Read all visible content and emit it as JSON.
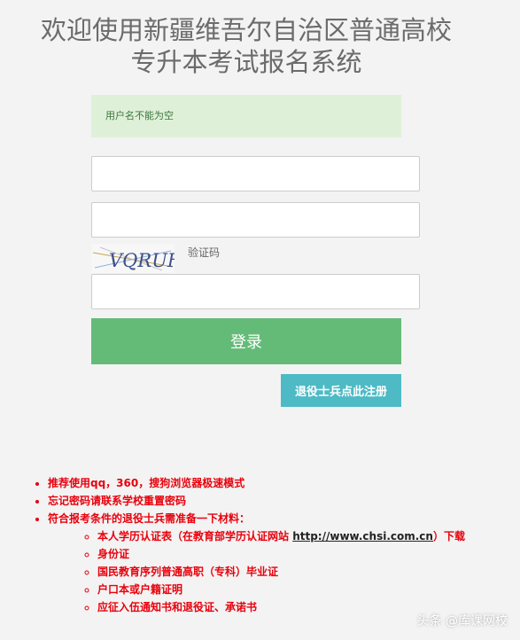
{
  "header": {
    "title_line1": "欢迎使用新疆维吾尔自治区普通高校",
    "title_line2": "专升本考试报名系统"
  },
  "alert": {
    "message": "用户名不能为空"
  },
  "form": {
    "username": {
      "value": "",
      "placeholder": ""
    },
    "password": {
      "value": "",
      "placeholder": ""
    },
    "captcha_image_text": "VQRUH",
    "captcha_label": "验证码",
    "captcha_input": {
      "value": "",
      "placeholder": ""
    },
    "login_label": "登录",
    "veteran_register_label": "退役士兵点此注册"
  },
  "notes": {
    "item1": "推荐使用qq，360，搜狗浏览器极速模式",
    "item2": "忘记密码请联系学校重置密码",
    "item3": "符合报考条件的退役士兵需准备一下材料：",
    "materials": {
      "m1_prefix": "本人学历认证表（在教育部学历认证网站 ",
      "m1_link": "http://www.chsi.com.cn",
      "m1_suffix": "）下载",
      "m2": "身份证",
      "m3": "国民教育序列普通高职（专科）毕业证",
      "m4": "户口本或户籍证明",
      "m5": "应征入伍通知书和退役证、承诺书"
    }
  },
  "watermark": {
    "text": "头条 @库课网校"
  },
  "colors": {
    "login_button": "#64bb78",
    "veteran_button": "#4dbac5",
    "alert_bg": "#dff0d8",
    "notes_text": "#e8000c"
  }
}
